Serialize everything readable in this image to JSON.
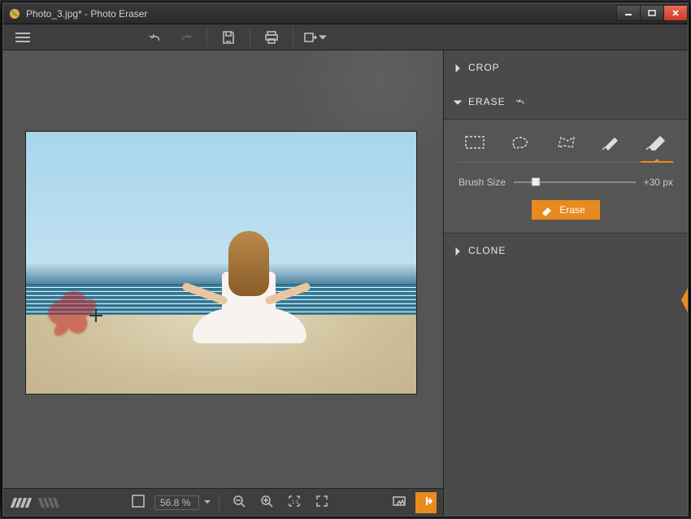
{
  "window": {
    "title": "Photo_3.jpg* - Photo Eraser"
  },
  "toolbar": {
    "menu": "menu",
    "undo": "undo",
    "redo": "redo",
    "save": "save",
    "print": "print",
    "export": "export"
  },
  "panels": {
    "crop": {
      "label": "CROP",
      "expanded": false
    },
    "erase": {
      "label": "ERASE",
      "expanded": true,
      "tools": [
        "rect-select",
        "lasso-select",
        "poly-select",
        "brush-small",
        "brush-large"
      ],
      "active_tool_index": 4,
      "brush_label": "Brush Size",
      "brush_value_text": "+30 px",
      "brush_value": 30,
      "brush_min": 1,
      "brush_max": 150,
      "cta_label": "Erase"
    },
    "clone": {
      "label": "CLONE",
      "expanded": false
    }
  },
  "status": {
    "zoom_text": "56.8 %",
    "zoom_value": 56.8
  },
  "accent_color": "#e78b1f"
}
